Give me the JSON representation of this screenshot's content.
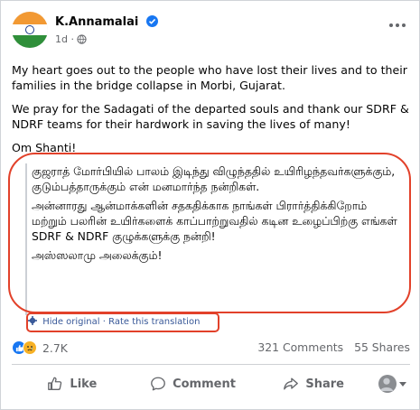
{
  "post": {
    "author": "K.Annamalai",
    "time": "1d",
    "meta_sep": "·",
    "paragraphs": [
      "My heart goes out to the people who have lost their lives and to their families in the bridge collapse in Morbi, Gujarat.",
      "We pray for the Sadagati of the departed souls and thank our SDRF & NDRF teams for their hardwork in saving the lives of many!",
      "Om Shanti!"
    ]
  },
  "translation": {
    "paragraphs": [
      "குஜராத் மோர்பியில் பாலம் இடிந்து விழுந்ததில் உயிரிழந்தவர்களுக்கும், குடும்பத்தாருக்கும் என் மனமார்ந்த நன்றிகள்.",
      "அன்னாரது ஆன்மாக்களின் சதகதிக்காக நாங்கள் பிரார்த்திக்கிறோம் மற்றும் பலரின் உயிர்களைக் காப்பாற்றுவதில் கடின உழைப்பிற்கு எங்கள் SDRF & NDRF குழுக்களுக்கு நன்றி!",
      "அஸ்ஸலாமு அலைக்கும்!"
    ],
    "hide_link": "Hide original",
    "link_sep": "·",
    "rate_link": "Rate this translation"
  },
  "stats": {
    "reaction_count": "2.7K",
    "comments": "321 Comments",
    "shares": "55 Shares"
  },
  "actions": {
    "like": "Like",
    "comment": "Comment",
    "share": "Share"
  },
  "colors": {
    "annotation": "#e2412a",
    "link": "#385898",
    "like": "#1877f2"
  },
  "icons": {
    "avatar": "indian-flag-avatar",
    "verified": "verified-badge-icon",
    "privacy": "globe-icon",
    "more": "more-dots-icon",
    "like": "thumbs-up-icon",
    "comment": "comment-bubble-icon",
    "share": "share-arrow-icon"
  }
}
